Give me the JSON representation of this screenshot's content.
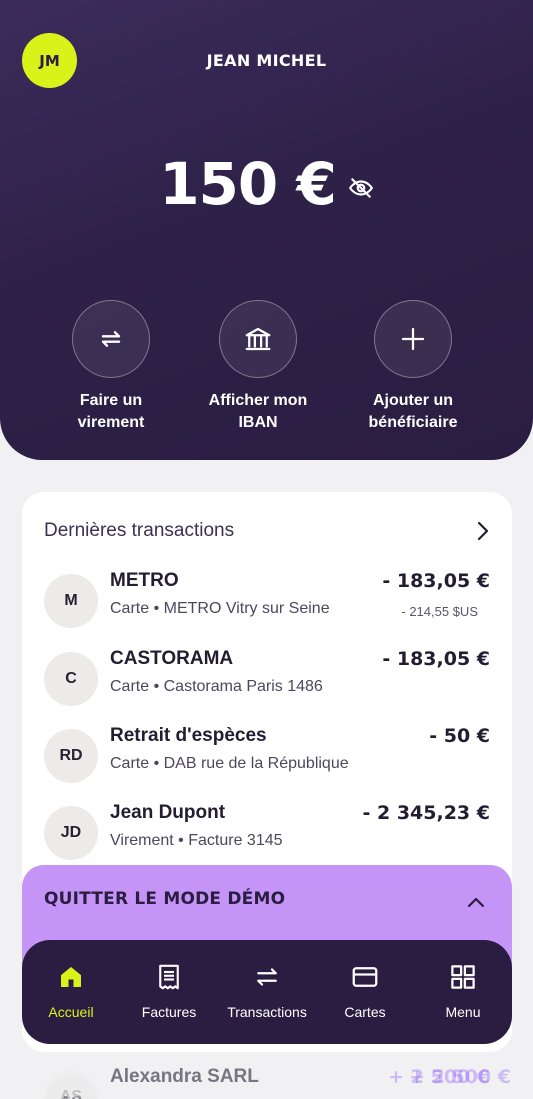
{
  "header": {
    "avatar_initials": "JM",
    "user_name": "JEAN MICHEL",
    "balance": "150 €",
    "colors": {
      "background": "#2e2148",
      "accent": "#d9f21a"
    }
  },
  "actions": [
    {
      "line1": "Faire un",
      "line2": "virement",
      "icon": "transfer-arrows-icon"
    },
    {
      "line1": "Afficher mon",
      "line2": "IBAN",
      "icon": "bank-icon"
    },
    {
      "line1": "Ajouter un",
      "line2": "bénéficiaire",
      "icon": "plus-icon"
    }
  ],
  "transactions": {
    "title": "Dernières transactions",
    "items": [
      {
        "initials": "M",
        "name": "METRO",
        "subtitle": "Carte • METRO Vitry sur Seine",
        "amount": "- 183,05 €",
        "amount_secondary": "- 214,55 $US"
      },
      {
        "initials": "C",
        "name": "CASTORAMA",
        "subtitle": "Carte • Castorama Paris 1486",
        "amount": "- 183,05 €"
      },
      {
        "initials": "RD",
        "name": "Retrait d'espèces",
        "subtitle": "Carte • DAB rue de la République",
        "amount": "- 50 €"
      },
      {
        "initials": "JD",
        "name": "Jean Dupont",
        "subtitle": "Virement • Facture 3145",
        "amount": "- 2 345,23 €"
      },
      {
        "initials": "AS",
        "name": "Alexandra SARL",
        "subtitle": "",
        "amount": "+ 2 500 €"
      }
    ]
  },
  "demo_banner": {
    "label": "QUITTER LE MODE DÉMO",
    "color": "#c495f6"
  },
  "bottom_nav": {
    "items": [
      {
        "label": "Accueil",
        "icon": "home-icon",
        "active": true
      },
      {
        "label": "Factures",
        "icon": "invoice-icon",
        "active": false
      },
      {
        "label": "Transactions",
        "icon": "transactions-arrows-icon",
        "active": false
      },
      {
        "label": "Cartes",
        "icon": "card-icon",
        "active": false
      },
      {
        "label": "Menu",
        "icon": "grid-menu-icon",
        "active": false
      }
    ]
  }
}
